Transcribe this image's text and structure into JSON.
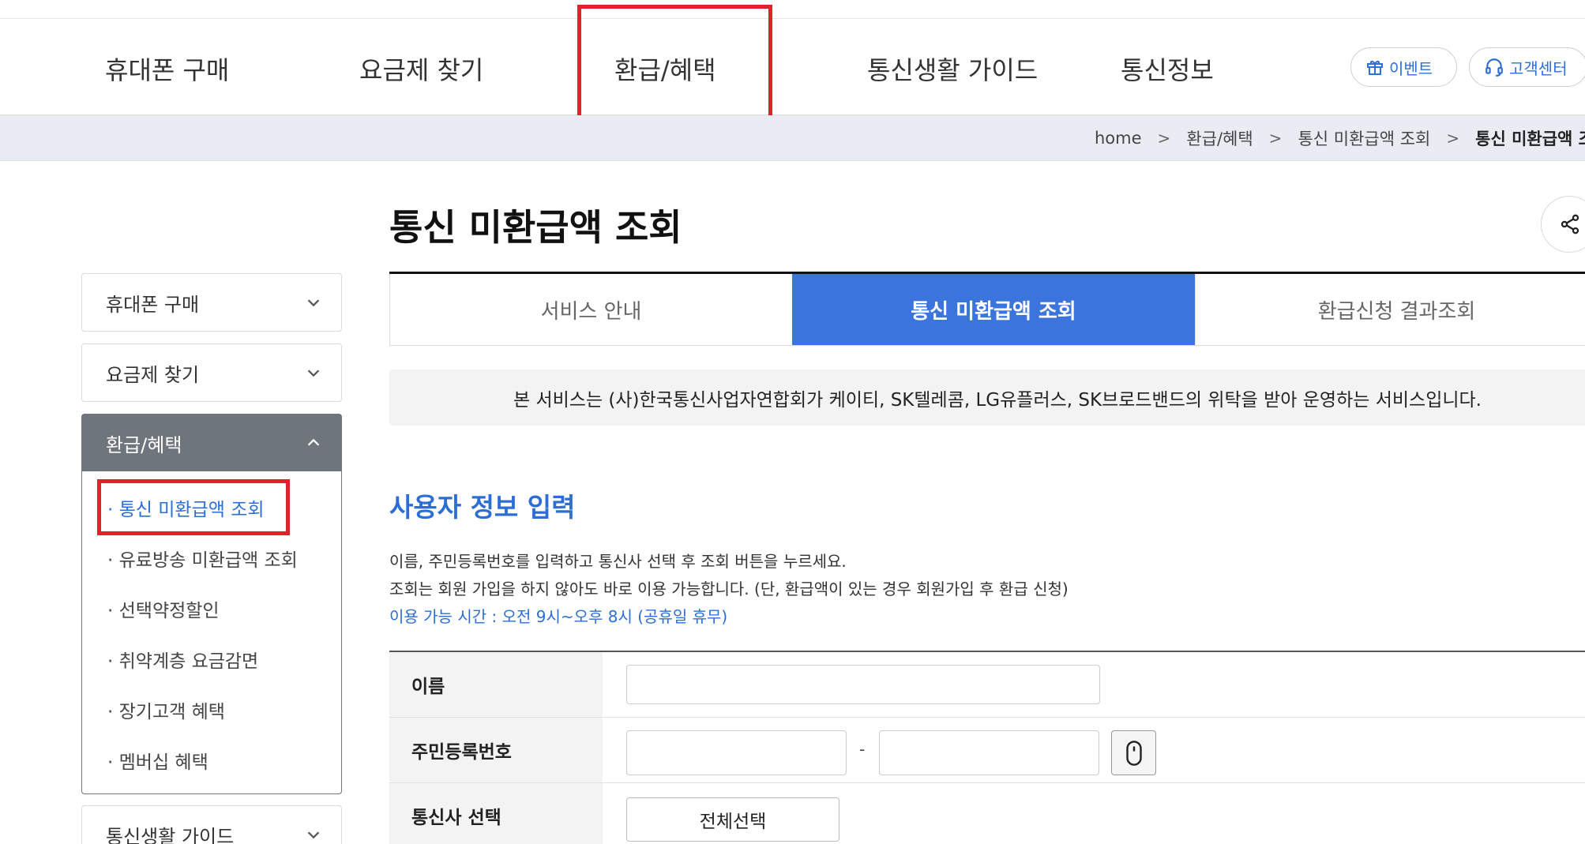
{
  "gnb": {
    "items": [
      "휴대폰 구매",
      "요금제 찾기",
      "환급/혜택",
      "통신생활 가이드",
      "통신정보"
    ],
    "event_label": "이벤트",
    "customer_label": "고객센터"
  },
  "breadcrumb": [
    "home",
    "환급/혜택",
    "통신 미환급액 조회",
    "통신 미환급액 조회"
  ],
  "page": {
    "title": "통신 미환급액 조회"
  },
  "lnb": {
    "groups": [
      {
        "label": "휴대폰 구매"
      },
      {
        "label": "요금제 찾기"
      },
      {
        "label": "환급/혜택",
        "items": [
          "· 통신 미환급액 조회",
          "· 유료방송 미환급액 조회",
          "· 선택약정할인",
          "· 취약계층 요금감면",
          "· 장기고객 혜택",
          "· 멤버십 혜택"
        ]
      },
      {
        "label": "통신생활 가이드"
      }
    ]
  },
  "tabs": [
    "서비스 안내",
    "통신 미환급액 조회",
    "환급신청 결과조회"
  ],
  "notice": "본 서비스는 (사)한국통신사업자연합회가 케이티, SK텔레콤, LG유플러스, SK브로드밴드의 위탁을 받아 운영하는 서비스입니다.",
  "section": {
    "title": "사용자 정보 입력",
    "desc1": "이름, 주민등록번호를 입력하고 통신사 선택 후 조회 버튼을 누르세요.",
    "desc2": "조회는 회원 가입을 하지 않아도 바로 이용 가능합니다. (단, 환급액이 있는 경우 회원가입 후 환급 신청)",
    "hours": "이용 가능 시간 : 오전 9시~오후 8시 (공휴일 휴무)"
  },
  "form": {
    "name_label": "이름",
    "name_value": "",
    "rrn_label": "주민등록번호",
    "rrn_front_value": "",
    "rrn_back_value": "",
    "rrn_dash": "-",
    "carrier_label": "통신사 선택",
    "select_all_label": "전체선택"
  },
  "colors": {
    "accent": "#3a74dc",
    "highlight": "#e0222b",
    "lnb_active": "#6f757c"
  },
  "icons": {
    "event": "gift-icon",
    "customer": "headset-icon",
    "share": "share-icon",
    "keypad": "mouse-icon"
  }
}
